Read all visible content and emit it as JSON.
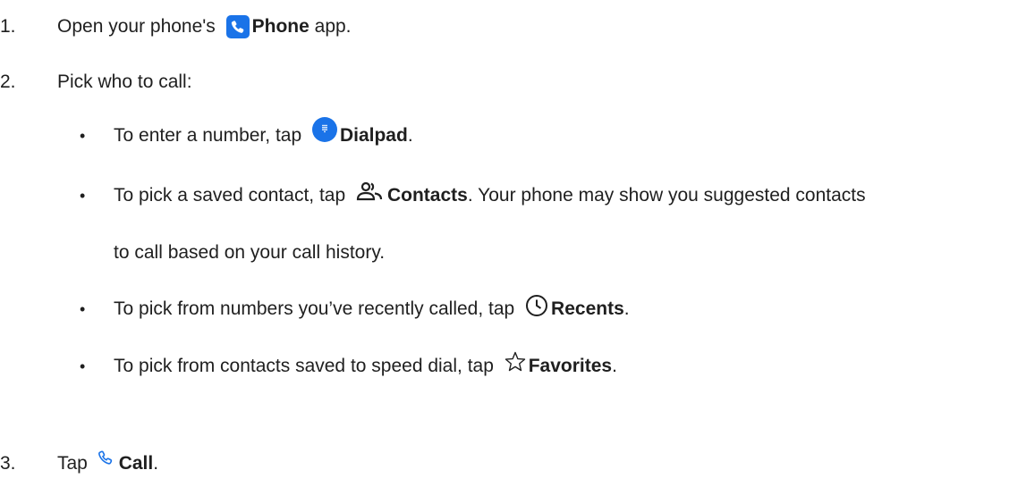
{
  "steps": [
    {
      "number": "1.",
      "before": "Open your phone's ",
      "bold": "Phone",
      "after": " app."
    },
    {
      "number": "2.",
      "text": "Pick who to call:"
    },
    {
      "number": "3.",
      "before": "Tap ",
      "bold": "Call",
      "after": "."
    }
  ],
  "options": [
    {
      "bullet": "•",
      "before": "To enter a number, tap ",
      "icon": "dialpad-icon",
      "bold": "Dialpad",
      "after": "."
    },
    {
      "bullet": "•",
      "before": "To pick a saved contact, tap ",
      "icon": "contacts-icon",
      "bold": "Contacts",
      "after": ". Your phone may show you suggested contacts",
      "continuation": "to call based on your call history."
    },
    {
      "bullet": "•",
      "before": "To pick from numbers you’ve recently called, tap ",
      "icon": "clock-icon",
      "bold": "Recents",
      "after": "."
    },
    {
      "bullet": "•",
      "before": "To pick from contacts saved to speed dial, tap ",
      "icon": "star-icon",
      "bold": "Favorites",
      "after": "."
    }
  ],
  "colors": {
    "text": "#1f1f1f",
    "accent_blue": "#1a73e8"
  }
}
